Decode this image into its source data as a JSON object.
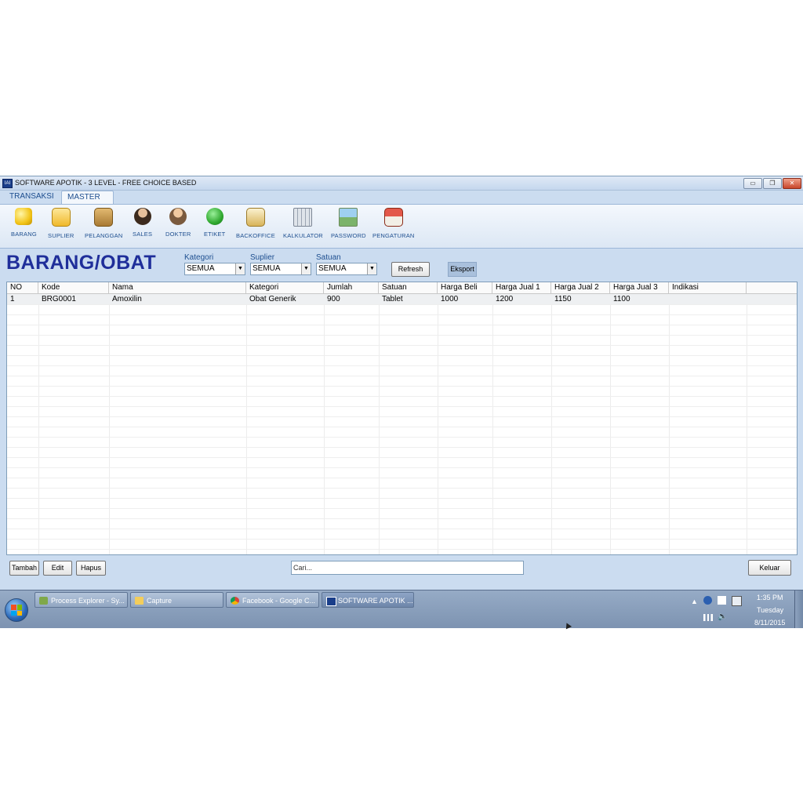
{
  "window": {
    "title": "SOFTWARE APOTIK - 3 LEVEL - FREE CHOICE BASED",
    "icon_text": "IAI",
    "controls": {
      "minimize": "▭",
      "restore": "❐",
      "close": "✕"
    }
  },
  "ribbon": {
    "tabs": [
      {
        "label": "TRANSAKSI"
      },
      {
        "label": "MASTER"
      }
    ],
    "buttons": [
      {
        "label": "BARANG",
        "icon": "coins-icon",
        "color": "#f2c418"
      },
      {
        "label": "SUPLIER",
        "icon": "folder-icon",
        "color": "#f5c94a"
      },
      {
        "label": "PELANGGAN",
        "icon": "box-icon",
        "color": "#c79a4a"
      },
      {
        "label": "SALES",
        "icon": "person-icon",
        "color": "#6b4a2e"
      },
      {
        "label": "DOKTER",
        "icon": "doctor-icon",
        "color": "#d29a6a"
      },
      {
        "label": "ETIKET",
        "icon": "speech-bubble-icon",
        "color": "#2fa82f"
      },
      {
        "label": "BACKOFFICE",
        "icon": "lock-document-icon",
        "color": "#d8b45a"
      },
      {
        "label": "KALKULATOR",
        "icon": "calculator-icon",
        "color": "#c5ccd6"
      },
      {
        "label": "PASSWORD",
        "icon": "password-image-icon",
        "color": "#7bb36a"
      },
      {
        "label": "PENGATURAN",
        "icon": "house-icon",
        "color": "#c93a2a"
      }
    ]
  },
  "page": {
    "title": "BARANG/OBAT"
  },
  "filters": {
    "kategori": {
      "label": "Kategori",
      "value": "SEMUA"
    },
    "suplier": {
      "label": "Suplier",
      "value": "SEMUA"
    },
    "satuan": {
      "label": "Satuan",
      "value": "SEMUA"
    },
    "refresh_label": "Refresh",
    "eksport_label": "Eksport"
  },
  "table": {
    "columns": [
      "NO",
      "Kode",
      "Nama",
      "Kategori",
      "Jumlah",
      "Satuan",
      "Harga Beli",
      "Harga Jual 1",
      "Harga Jual 2",
      "Harga Jual 3",
      "Indikasi"
    ],
    "rows": [
      [
        "1",
        "BRG0001",
        "Amoxilin",
        "Obat Generik",
        "900",
        "Tablet",
        "1000",
        "1200",
        "1150",
        "1100",
        ""
      ]
    ]
  },
  "actions": {
    "tambah_label": "Tambah",
    "edit_label": "Edit",
    "hapus_label": "Hapus",
    "search_placeholder": "Cari...",
    "keluar_label": "Keluar"
  },
  "taskbar": {
    "items": [
      {
        "label": "Process Explorer - Sy...",
        "icon": "process-explorer-icon"
      },
      {
        "label": "Capture",
        "icon": "folder-icon"
      },
      {
        "label": "Facebook - Google C...",
        "icon": "chrome-icon"
      },
      {
        "label": "SOFTWARE APOTIK ...",
        "icon": "app-icon"
      }
    ],
    "clock": {
      "time": "1:35 PM",
      "day": "Tuesday",
      "date": "8/11/2015"
    }
  }
}
